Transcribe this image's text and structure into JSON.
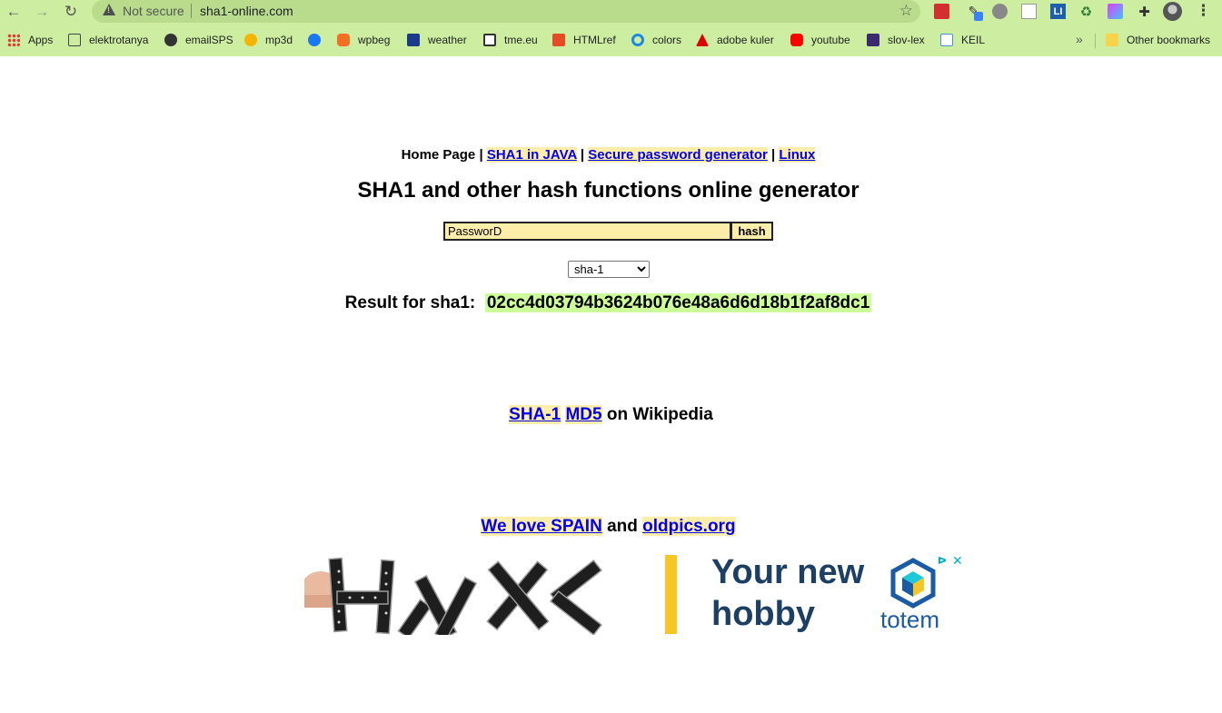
{
  "browser": {
    "nav": {
      "back": "←",
      "forward": "→",
      "reload": "↻"
    },
    "omnibox": {
      "security_status": "Not secure",
      "url": "sha1-online.com"
    },
    "star": "☆",
    "menu": "⋮",
    "extensions": [
      "",
      "✎",
      "",
      "",
      "LI",
      "♻",
      "",
      "✚"
    ],
    "bookmarks": [
      {
        "label": "Apps",
        "icon": "apps-grid-icon"
      },
      {
        "label": "elektrotanya",
        "icon": "elektrotanya-icon"
      },
      {
        "label": "emailSPS",
        "icon": "globe-icon"
      },
      {
        "label": "mp3d",
        "icon": "sk-icon"
      },
      {
        "label": "",
        "icon": "facebook-icon"
      },
      {
        "label": "wpbeg",
        "icon": "wpbeg-icon"
      },
      {
        "label": "weather",
        "icon": "weather-channel-icon"
      },
      {
        "label": "tme.eu",
        "icon": "tme-icon"
      },
      {
        "label": "HTMLref",
        "icon": "html5-icon"
      },
      {
        "label": "colors",
        "icon": "colors-icon"
      },
      {
        "label": "adobe kuler",
        "icon": "adobe-icon"
      },
      {
        "label": "youtube",
        "icon": "youtube-icon"
      },
      {
        "label": "slov-lex",
        "icon": "slov-lex-icon"
      },
      {
        "label": "KEIL",
        "icon": "keil-icon"
      }
    ],
    "more_bookmarks": "»",
    "other_bookmarks": "Other bookmarks"
  },
  "page": {
    "nav": {
      "home": "Home Page",
      "separator": " | ",
      "sha1_java": "SHA1 in JAVA",
      "password_gen": "Secure password generator",
      "linux": "Linux"
    },
    "title": "SHA1 and other hash functions online generator",
    "form": {
      "input_value": "PassworD",
      "button_label": "hash",
      "algorithm_selected": "sha-1"
    },
    "result": {
      "label": "Result for sha1:",
      "hash": "02cc4d03794b3624b076e48a6d6d18b1f2af8dc1"
    },
    "wiki": {
      "sha1": "SHA-1",
      "md5": "MD5",
      "suffix": "on Wikipedia"
    },
    "spain": {
      "link1": "We love SPAIN",
      "and": "and",
      "link2": "oldpics.org"
    },
    "ad": {
      "line1": "Your new",
      "line2": "hobby",
      "brand": "totem",
      "choices": "ᐅ",
      "close": "✕",
      "accent": "#f6c625",
      "text_color": "#1d3f63"
    }
  }
}
